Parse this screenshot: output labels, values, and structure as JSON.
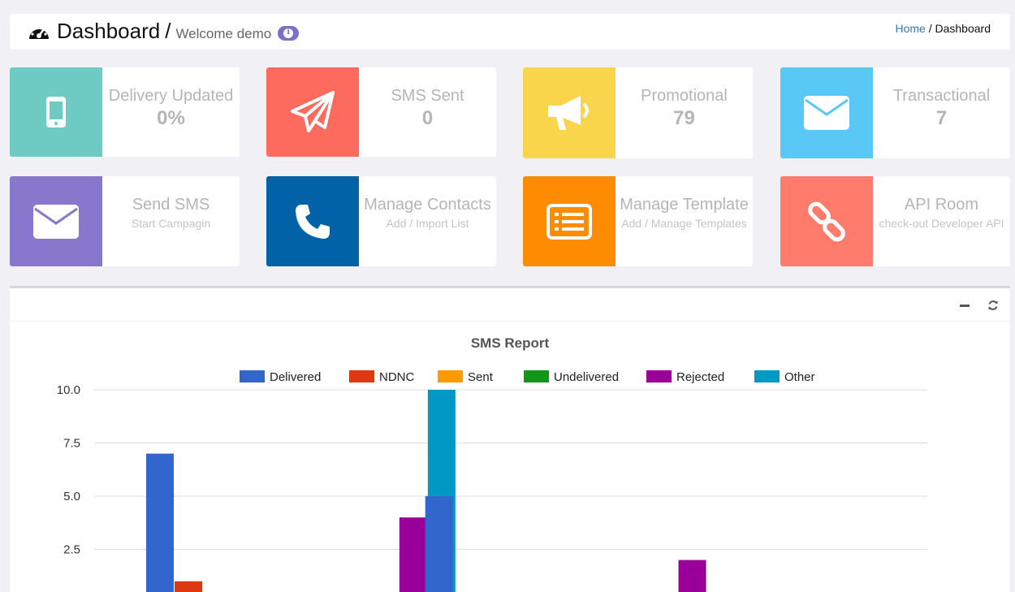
{
  "header": {
    "title": "Dashboard",
    "slash": "/",
    "welcome": "Welcome demo",
    "breadcrumb": {
      "home": "Home",
      "sep": " / ",
      "current": "Dashboard"
    }
  },
  "cards": [
    {
      "label": "Delivery Updated",
      "value": "0%",
      "color": "#6dcbc4",
      "icon": "mobile-icon"
    },
    {
      "label": "SMS Sent",
      "value": "0",
      "color": "#fd6b5f",
      "icon": "paper-plane-icon"
    },
    {
      "label": "Promotional",
      "value": "79",
      "color": "#f9d54c",
      "icon": "megaphone-icon"
    },
    {
      "label": "Transactional",
      "value": "7",
      "color": "#5ac8f5",
      "icon": "envelope-icon"
    },
    {
      "label": "Send SMS",
      "sub": "Start Campagin",
      "color": "#8778cd",
      "icon": "envelope-icon"
    },
    {
      "label": "Manage Contacts",
      "sub": "Add / Import List",
      "color": "#0162a8",
      "icon": "phone-icon"
    },
    {
      "label": "Manage Template",
      "sub": "Add / Manage Templates",
      "color": "#fe8c02",
      "icon": "list-alt-icon"
    },
    {
      "label": "API Room",
      "sub": "check-out Developer API",
      "color": "#ff7b6c",
      "icon": "link-icon"
    }
  ],
  "chart_data": {
    "type": "bar",
    "title": "SMS Report",
    "ylim": [
      0,
      10
    ],
    "yticks": [
      "10.0",
      "7.5",
      "5.0",
      "2.5"
    ],
    "ytick_values": [
      10,
      7.5,
      5,
      2.5
    ],
    "grid": true,
    "legend_position": "top-center",
    "series": [
      {
        "name": "Delivered",
        "color": "#3366cc",
        "values": [
          7,
          0,
          5,
          0
        ]
      },
      {
        "name": "NDNC",
        "color": "#dc3912",
        "values": [
          1,
          0,
          0,
          0
        ]
      },
      {
        "name": "Sent",
        "color": "#ff9900",
        "values": [
          0,
          0,
          0,
          0
        ]
      },
      {
        "name": "Undelivered",
        "color": "#109618",
        "values": [
          0,
          0,
          0,
          0
        ]
      },
      {
        "name": "Rejected",
        "color": "#990099",
        "values": [
          0,
          4,
          0,
          2
        ]
      },
      {
        "name": "Other",
        "color": "#0099c6",
        "values": [
          0,
          10,
          0,
          0
        ]
      }
    ]
  }
}
